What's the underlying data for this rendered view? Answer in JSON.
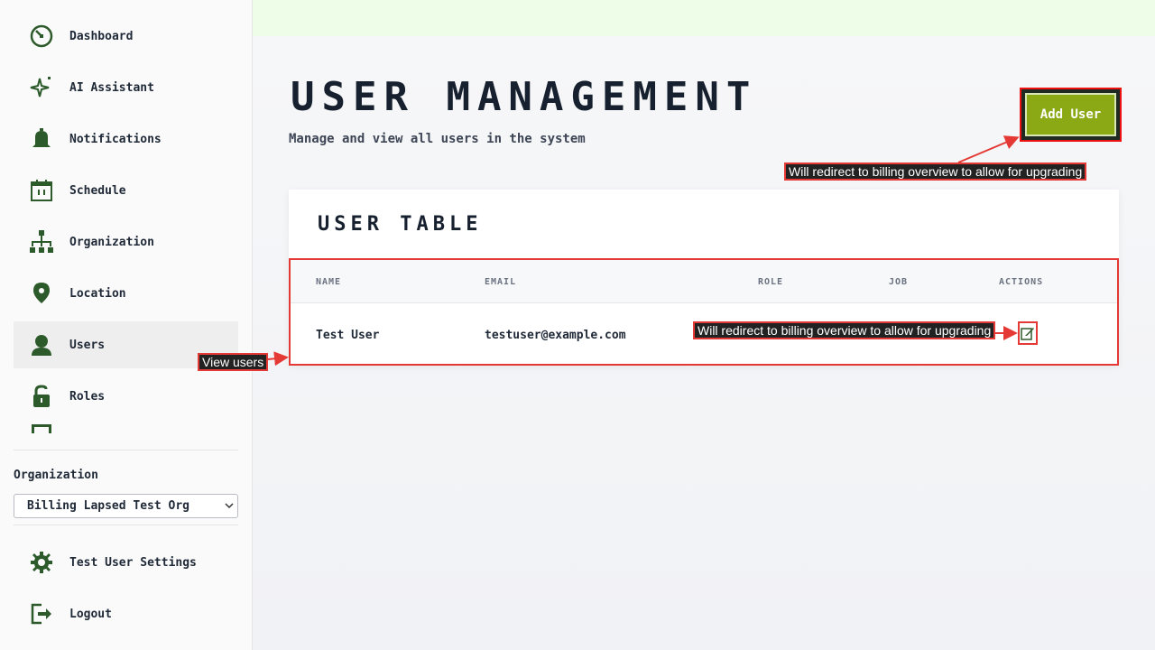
{
  "sidebar": {
    "items": [
      {
        "label": "Dashboard",
        "icon": "dashboard-icon"
      },
      {
        "label": "AI Assistant",
        "icon": "sparkle-icon"
      },
      {
        "label": "Notifications",
        "icon": "bell-icon"
      },
      {
        "label": "Schedule",
        "icon": "calendar-icon"
      },
      {
        "label": "Organization",
        "icon": "org-chart-icon"
      },
      {
        "label": "Location",
        "icon": "location-pin-icon"
      },
      {
        "label": "Users",
        "icon": "user-icon",
        "active": true
      },
      {
        "label": "Roles",
        "icon": "lock-icon"
      }
    ],
    "org_label": "Organization",
    "org_selected": "Billing Lapsed Test Org",
    "settings_label": "Test User Settings",
    "logout_label": "Logout"
  },
  "page": {
    "title": "USER MANAGEMENT",
    "subtitle": "Manage and view all users in the system",
    "add_button": "Add User"
  },
  "table": {
    "title": "USER TABLE",
    "headers": [
      "NAME",
      "EMAIL",
      "ROLE",
      "JOB",
      "ACTIONS"
    ],
    "rows": [
      {
        "name": "Test User",
        "email": "testuser@example.com",
        "role": "",
        "job": ""
      }
    ]
  },
  "annotations": {
    "add_user": "Will redirect to billing overview to allow for upgrading",
    "edit_user": "Will redirect to billing overview to allow for upgrading",
    "view_users": "View users"
  },
  "colors": {
    "accent": "#8aa915",
    "icon": "#2d5a2a",
    "annotation_border": "#e53935",
    "topbar": "#edfde8"
  }
}
